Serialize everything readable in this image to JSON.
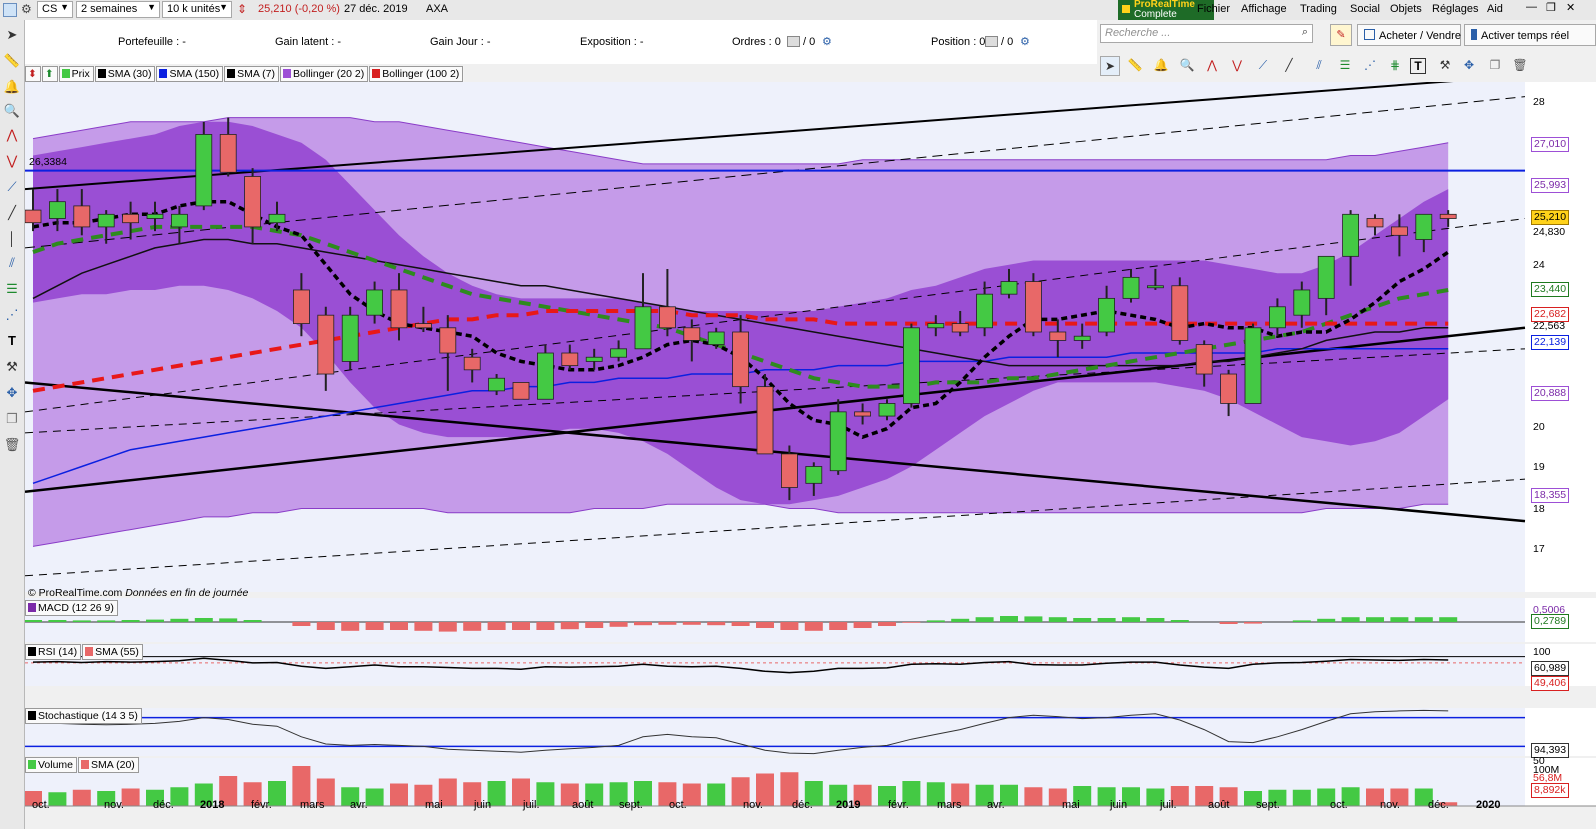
{
  "topbar": {
    "symbol": "CS",
    "period": "2 semaines",
    "units": "10 k unités",
    "price_change": "25,210 (-0,20 %)",
    "date": "27 déc. 2019",
    "name": "AXA",
    "brand_line1": "ProRealTime",
    "brand_line2": "Complete",
    "menu": [
      "Fichier",
      "Affichage",
      "Trading",
      "Social",
      "Objets",
      "Réglages",
      "Aid"
    ]
  },
  "info": {
    "portefeuille": "Portefeuille : -",
    "gain_latent": "Gain latent : -",
    "gain_jour": "Gain Jour : -",
    "exposition": "Exposition : -",
    "ordres": "Ordres : 0",
    "ordres_b": "/ 0",
    "position": "Position : 0",
    "position_b": "/ 0"
  },
  "right_panel": {
    "search_placeholder": "Recherche ...",
    "buy_sell": "Acheter / Vendre",
    "realtime": "Activer temps réel"
  },
  "legend": [
    {
      "label": "Prix",
      "color": "#44c944"
    },
    {
      "label": "SMA (30)",
      "color": "#000000"
    },
    {
      "label": "SMA (150)",
      "color": "#0b20e0"
    },
    {
      "label": "SMA (7)",
      "color": "#000000"
    },
    {
      "label": "Bollinger (20 2)",
      "color": "#9d4fd6"
    },
    {
      "label": "Bollinger (100 2)",
      "color": "#d82020"
    }
  ],
  "level_label": "26,3384",
  "copyright": "© ProRealTime.com",
  "copyright_note": "Données en fin de journée",
  "panels": {
    "macd": "MACD (12 26 9)",
    "rsi": "RSI (14)",
    "rsi_sma": "SMA (55)",
    "stoch": "Stochastique (14 3 5)",
    "volume": "Volume",
    "volume_sma": "SMA (20)"
  },
  "price_axis": [
    "28",
    "27,010",
    "25,993",
    "25,210",
    "24,830",
    "24",
    "23,440",
    "22,682",
    "22,563",
    "22,139",
    "20,888",
    "20",
    "19",
    "18,355",
    "18",
    "17"
  ],
  "indicator_axis": [
    "0,5006",
    "0,2789",
    "100",
    "60,989",
    "49,406",
    "94,393",
    "50",
    "100M",
    "56,8M",
    "8,892k"
  ],
  "months": [
    "oct.",
    "nov.",
    "déc.",
    "2018",
    "févr.",
    "mars",
    "avr.",
    "mai",
    "juin",
    "juil.",
    "août",
    "sept.",
    "oct.",
    "nov.",
    "déc.",
    "2019",
    "févr.",
    "mars",
    "avr.",
    "mai",
    "juin",
    "juil.",
    "août",
    "sept.",
    "oct.",
    "nov.",
    "déc.",
    "2020"
  ],
  "chart_data": {
    "type": "candlestick",
    "symbol": "AXA",
    "period": "2 semaines",
    "ylim": [
      16.6,
      28.4
    ],
    "candles": [
      {
        "o": 25.4,
        "h": 25.9,
        "l": 24.9,
        "c": 25.1
      },
      {
        "o": 25.2,
        "h": 25.9,
        "l": 24.9,
        "c": 25.6
      },
      {
        "o": 25.5,
        "h": 25.9,
        "l": 24.8,
        "c": 25.0
      },
      {
        "o": 25.0,
        "h": 25.4,
        "l": 24.6,
        "c": 25.3
      },
      {
        "o": 25.3,
        "h": 25.6,
        "l": 24.7,
        "c": 25.1
      },
      {
        "o": 25.2,
        "h": 25.6,
        "l": 24.9,
        "c": 25.3
      },
      {
        "o": 25.0,
        "h": 25.5,
        "l": 24.6,
        "c": 25.3
      },
      {
        "o": 25.5,
        "h": 27.5,
        "l": 25.4,
        "c": 27.2
      },
      {
        "o": 27.2,
        "h": 27.6,
        "l": 26.2,
        "c": 26.3
      },
      {
        "o": 26.2,
        "h": 26.4,
        "l": 24.6,
        "c": 25.0
      },
      {
        "o": 25.1,
        "h": 25.6,
        "l": 24.9,
        "c": 25.3
      },
      {
        "o": 23.5,
        "h": 23.9,
        "l": 22.4,
        "c": 22.7
      },
      {
        "o": 22.9,
        "h": 23.1,
        "l": 21.1,
        "c": 21.5
      },
      {
        "o": 21.8,
        "h": 23.1,
        "l": 21.6,
        "c": 22.9
      },
      {
        "o": 22.9,
        "h": 23.7,
        "l": 22.7,
        "c": 23.5
      },
      {
        "o": 23.5,
        "h": 23.9,
        "l": 22.3,
        "c": 22.6
      },
      {
        "o": 22.7,
        "h": 23.1,
        "l": 22.5,
        "c": 22.6
      },
      {
        "o": 22.6,
        "h": 22.9,
        "l": 21.1,
        "c": 22.0
      },
      {
        "o": 21.9,
        "h": 22.1,
        "l": 21.3,
        "c": 21.6
      },
      {
        "o": 21.1,
        "h": 21.5,
        "l": 21.0,
        "c": 21.4
      },
      {
        "o": 21.3,
        "h": 21.3,
        "l": 20.9,
        "c": 20.9
      },
      {
        "o": 20.9,
        "h": 22.2,
        "l": 20.9,
        "c": 22.0
      },
      {
        "o": 22.0,
        "h": 22.2,
        "l": 21.6,
        "c": 21.7
      },
      {
        "o": 21.8,
        "h": 22.1,
        "l": 21.6,
        "c": 21.9
      },
      {
        "o": 21.9,
        "h": 22.3,
        "l": 21.8,
        "c": 22.1
      },
      {
        "o": 22.1,
        "h": 23.9,
        "l": 22.1,
        "c": 23.1
      },
      {
        "o": 23.1,
        "h": 24.0,
        "l": 22.4,
        "c": 22.6
      },
      {
        "o": 22.6,
        "h": 22.8,
        "l": 21.8,
        "c": 22.3
      },
      {
        "o": 22.2,
        "h": 22.6,
        "l": 22.1,
        "c": 22.5
      },
      {
        "o": 22.5,
        "h": 22.9,
        "l": 20.8,
        "c": 21.2
      },
      {
        "o": 21.2,
        "h": 21.5,
        "l": 19.9,
        "c": 19.6
      },
      {
        "o": 19.6,
        "h": 19.8,
        "l": 18.5,
        "c": 18.8
      },
      {
        "o": 18.9,
        "h": 19.4,
        "l": 18.6,
        "c": 19.3
      },
      {
        "o": 19.2,
        "h": 20.9,
        "l": 19.1,
        "c": 20.6
      },
      {
        "o": 20.6,
        "h": 20.8,
        "l": 20.3,
        "c": 20.5
      },
      {
        "o": 20.5,
        "h": 20.9,
        "l": 20.4,
        "c": 20.8
      },
      {
        "o": 20.8,
        "h": 22.7,
        "l": 20.7,
        "c": 22.6
      },
      {
        "o": 22.6,
        "h": 22.9,
        "l": 22.4,
        "c": 22.7
      },
      {
        "o": 22.7,
        "h": 23.0,
        "l": 22.4,
        "c": 22.5
      },
      {
        "o": 22.6,
        "h": 23.7,
        "l": 22.4,
        "c": 23.4
      },
      {
        "o": 23.4,
        "h": 24.0,
        "l": 23.3,
        "c": 23.7
      },
      {
        "o": 23.7,
        "h": 23.9,
        "l": 22.4,
        "c": 22.5
      },
      {
        "o": 22.5,
        "h": 22.8,
        "l": 21.9,
        "c": 22.3
      },
      {
        "o": 22.3,
        "h": 22.7,
        "l": 22.1,
        "c": 22.4
      },
      {
        "o": 22.5,
        "h": 23.6,
        "l": 22.4,
        "c": 23.3
      },
      {
        "o": 23.3,
        "h": 24.0,
        "l": 23.2,
        "c": 23.8
      },
      {
        "o": 23.6,
        "h": 24.0,
        "l": 23.5,
        "c": 23.6
      },
      {
        "o": 23.6,
        "h": 23.8,
        "l": 22.2,
        "c": 22.3
      },
      {
        "o": 22.2,
        "h": 22.3,
        "l": 21.2,
        "c": 21.5
      },
      {
        "o": 21.5,
        "h": 21.6,
        "l": 20.5,
        "c": 20.8
      },
      {
        "o": 20.8,
        "h": 22.7,
        "l": 20.8,
        "c": 22.6
      },
      {
        "o": 22.6,
        "h": 23.3,
        "l": 22.4,
        "c": 23.1
      },
      {
        "o": 22.9,
        "h": 23.7,
        "l": 22.6,
        "c": 23.5
      },
      {
        "o": 23.3,
        "h": 24.3,
        "l": 22.9,
        "c": 24.3
      },
      {
        "o": 24.3,
        "h": 25.4,
        "l": 23.6,
        "c": 25.3
      },
      {
        "o": 25.2,
        "h": 25.3,
        "l": 24.8,
        "c": 25.0
      },
      {
        "o": 25.0,
        "h": 25.3,
        "l": 24.3,
        "c": 24.8
      },
      {
        "o": 24.7,
        "h": 25.3,
        "l": 24.4,
        "c": 25.3
      },
      {
        "o": 25.3,
        "h": 25.4,
        "l": 25.0,
        "c": 25.2
      }
    ],
    "sma7": [
      25.0,
      25.1,
      25.1,
      25.2,
      25.3,
      25.3,
      25.5,
      25.6,
      25.6,
      25.3,
      25.0,
      24.8,
      24.1,
      23.4,
      23.0,
      22.7,
      22.6,
      22.5,
      22.4,
      22.0,
      21.8,
      21.7,
      21.6,
      21.6,
      21.7,
      21.9,
      22.2,
      22.3,
      22.2,
      21.9,
      21.4,
      20.8,
      20.4,
      20.3,
      20.0,
      20.2,
      20.7,
      20.8,
      21.3,
      21.9,
      22.4,
      22.8,
      22.8,
      22.9,
      23.0,
      22.9,
      22.8,
      22.6,
      22.7,
      22.6,
      22.6,
      22.4,
      22.5,
      22.5,
      22.8,
      23.2,
      23.7,
      24.0,
      24.4
    ],
    "sma30": [
      23.3,
      23.6,
      23.9,
      24.1,
      24.3,
      24.5,
      24.6,
      24.7,
      24.7,
      24.6,
      24.6,
      24.5,
      24.4,
      24.3,
      24.2,
      24.1,
      24.0,
      23.9,
      23.8,
      23.7,
      23.6,
      23.6,
      23.5,
      23.4,
      23.3,
      23.2,
      23.1,
      23.0,
      22.9,
      22.8,
      22.7,
      22.6,
      22.5,
      22.4,
      22.3,
      22.2,
      22.1,
      22.0,
      21.9,
      21.8,
      21.7,
      21.7,
      21.7,
      21.7,
      21.7,
      21.7,
      21.7,
      21.7,
      21.8,
      21.8,
      21.9,
      22.0,
      22.1,
      22.3,
      22.4,
      22.5,
      22.5,
      22.6,
      22.6
    ],
    "sma150": [
      18.9,
      19.1,
      19.3,
      19.5,
      19.7,
      19.8,
      19.9,
      20.0,
      20.1,
      20.2,
      20.3,
      20.4,
      20.5,
      20.6,
      20.7,
      20.8,
      20.9,
      21.0,
      21.1,
      21.1,
      21.2,
      21.2,
      21.3,
      21.3,
      21.4,
      21.4,
      21.4,
      21.5,
      21.5,
      21.5,
      21.6,
      21.6,
      21.6,
      21.7,
      21.7,
      21.7,
      21.8,
      21.8,
      21.8,
      21.8,
      21.9,
      21.9,
      21.9,
      21.9,
      21.9,
      22.0,
      22.0,
      22.0,
      22.0,
      22.0,
      22.0,
      22.1,
      22.1,
      22.1,
      22.1,
      22.1,
      22.1,
      22.1,
      22.1
    ],
    "sma_green": [
      24.4,
      24.6,
      24.7,
      24.8,
      24.9,
      25.0,
      25.0,
      25.0,
      25.0,
      25.0,
      24.9,
      24.8,
      24.6,
      24.4,
      24.2,
      24.0,
      23.8,
      23.6,
      23.4,
      23.3,
      23.2,
      23.1,
      23.0,
      22.9,
      22.8,
      22.7,
      22.6,
      22.4,
      22.2,
      22.0,
      21.8,
      21.6,
      21.4,
      21.3,
      21.2,
      21.2,
      21.2,
      21.3,
      21.3,
      21.3,
      21.4,
      21.4,
      21.5,
      21.6,
      21.7,
      21.8,
      21.9,
      22.0,
      22.1,
      22.2,
      22.3,
      22.4,
      22.5,
      22.7,
      22.9,
      23.1,
      23.3,
      23.4,
      23.5
    ],
    "sma_red": [
      21.1,
      21.2,
      21.3,
      21.4,
      21.5,
      21.6,
      21.7,
      21.8,
      21.9,
      22.0,
      22.1,
      22.2,
      22.3,
      22.4,
      22.5,
      22.6,
      22.7,
      22.8,
      22.8,
      22.9,
      22.9,
      23.0,
      23.0,
      23.0,
      23.0,
      23.0,
      23.0,
      22.9,
      22.9,
      22.9,
      22.8,
      22.8,
      22.8,
      22.7,
      22.7,
      22.7,
      22.7,
      22.7,
      22.7,
      22.7,
      22.7,
      22.7,
      22.7,
      22.7,
      22.7,
      22.7,
      22.7,
      22.7,
      22.7,
      22.7,
      22.7,
      22.7,
      22.7,
      22.7,
      22.7,
      22.7,
      22.7,
      22.7,
      22.7
    ],
    "bb20_upper": [
      26.7,
      26.8,
      26.9,
      27.0,
      27.1,
      27.2,
      27.4,
      27.5,
      27.5,
      27.4,
      27.2,
      27.0,
      26.6,
      26.0,
      25.4,
      24.8,
      24.3,
      23.9,
      23.6,
      23.4,
      23.3,
      23.3,
      23.3,
      23.3,
      23.3,
      23.2,
      23.1,
      23.0,
      23.0,
      23.0,
      23.0,
      23.0,
      23.0,
      23.1,
      23.2,
      23.3,
      23.5,
      23.6,
      23.8,
      24.0,
      24.1,
      24.2,
      24.2,
      24.2,
      24.2,
      24.2,
      24.2,
      24.2,
      24.2,
      24.1,
      24.0,
      23.9,
      23.9,
      24.1,
      24.4,
      24.8,
      25.2,
      25.6,
      25.9
    ],
    "bb20_lower": [
      23.2,
      23.3,
      23.4,
      23.4,
      23.5,
      23.5,
      23.6,
      23.6,
      23.5,
      23.3,
      23.0,
      22.6,
      22.0,
      21.3,
      20.7,
      20.3,
      20.1,
      20.0,
      20.0,
      20.0,
      20.0,
      20.1,
      20.2,
      20.2,
      20.1,
      19.9,
      19.6,
      19.2,
      18.8,
      18.5,
      18.4,
      18.4,
      18.5,
      18.6,
      18.8,
      19.0,
      19.3,
      19.7,
      20.1,
      20.5,
      20.8,
      21.1,
      21.3,
      21.3,
      21.3,
      21.3,
      21.3,
      21.2,
      21.1,
      20.9,
      20.6,
      20.3,
      20.0,
      19.9,
      19.8,
      19.9,
      20.1,
      20.5,
      20.9
    ],
    "bb100_upper": [
      27.1,
      27.2,
      27.3,
      27.4,
      27.5,
      27.5,
      27.5,
      27.5,
      27.6,
      27.6,
      27.6,
      27.6,
      27.6,
      27.6,
      27.5,
      27.5,
      27.4,
      27.3,
      27.2,
      27.1,
      27.0,
      26.9,
      26.8,
      26.7,
      26.6,
      26.5,
      26.5,
      26.5,
      26.5,
      26.5,
      26.5,
      26.5,
      26.5,
      26.5,
      26.6,
      26.6,
      26.6,
      26.6,
      26.6,
      26.6,
      26.6,
      26.6,
      26.6,
      26.6,
      26.6,
      26.6,
      26.6,
      26.6,
      26.6,
      26.6,
      26.6,
      26.6,
      26.6,
      26.6,
      26.7,
      26.7,
      26.8,
      26.9,
      27.0
    ],
    "bb100_lower": [
      17.4,
      17.5,
      17.6,
      17.7,
      17.8,
      17.9,
      18.0,
      18.1,
      18.1,
      18.2,
      18.2,
      18.3,
      18.3,
      18.3,
      18.3,
      18.3,
      18.3,
      18.2,
      18.2,
      18.2,
      18.2,
      18.2,
      18.2,
      18.3,
      18.3,
      18.3,
      18.4,
      18.4,
      18.4,
      18.4,
      18.4,
      18.3,
      18.3,
      18.2,
      18.2,
      18.2,
      18.2,
      18.2,
      18.2,
      18.2,
      18.2,
      18.2,
      18.2,
      18.2,
      18.2,
      18.2,
      18.2,
      18.2,
      18.2,
      18.2,
      18.2,
      18.2,
      18.2,
      18.3,
      18.3,
      18.3,
      18.3,
      18.4,
      18.4
    ],
    "horizontal_level": 26.3384,
    "macd_hist": [
      0.05,
      0.05,
      0.04,
      0.04,
      0.05,
      0.06,
      0.08,
      0.1,
      0.09,
      0.05,
      0.0,
      -0.1,
      -0.2,
      -0.22,
      -0.2,
      -0.2,
      -0.22,
      -0.24,
      -0.22,
      -0.2,
      -0.2,
      -0.2,
      -0.18,
      -0.15,
      -0.12,
      -0.08,
      -0.07,
      -0.07,
      -0.08,
      -0.1,
      -0.15,
      -0.2,
      -0.22,
      -0.2,
      -0.15,
      -0.1,
      -0.02,
      0.04,
      0.08,
      0.12,
      0.15,
      0.14,
      0.12,
      0.1,
      0.1,
      0.12,
      0.1,
      0.05,
      0.0,
      -0.05,
      -0.04,
      0.0,
      0.04,
      0.08,
      0.12,
      0.12,
      0.12,
      0.12,
      0.12
    ],
    "rsi": [
      57,
      58,
      56,
      58,
      57,
      58,
      60,
      66,
      61,
      55,
      56,
      47,
      42,
      46,
      50,
      46,
      46,
      44,
      42,
      42,
      40,
      46,
      45,
      46,
      47,
      52,
      47,
      46,
      47,
      42,
      35,
      32,
      35,
      42,
      42,
      43,
      52,
      53,
      52,
      56,
      58,
      51,
      50,
      50,
      54,
      57,
      57,
      50,
      45,
      42,
      52,
      55,
      56,
      59,
      63,
      62,
      61,
      63,
      62
    ],
    "stoch": [
      70,
      68,
      66,
      65,
      66,
      68,
      72,
      80,
      76,
      66,
      62,
      40,
      25,
      22,
      24,
      22,
      20,
      14,
      12,
      10,
      8,
      12,
      15,
      18,
      22,
      40,
      45,
      40,
      38,
      25,
      12,
      6,
      5,
      12,
      18,
      22,
      35,
      45,
      55,
      68,
      80,
      85,
      82,
      78,
      80,
      85,
      88,
      75,
      55,
      30,
      28,
      40,
      55,
      72,
      88,
      92,
      94,
      95,
      94
    ],
    "volume": [
      12,
      11,
      13,
      12,
      14,
      13,
      15,
      18,
      24,
      19,
      20,
      32,
      22,
      15,
      14,
      18,
      17,
      22,
      19,
      20,
      22,
      19,
      18,
      18,
      19,
      20,
      19,
      18,
      18,
      23,
      26,
      27,
      20,
      17,
      17,
      16,
      20,
      19,
      18,
      17,
      17,
      15,
      14,
      16,
      15,
      15,
      14,
      16,
      16,
      15,
      12,
      13,
      13,
      14,
      15,
      14,
      14,
      14,
      3
    ],
    "colors": {
      "up": "#44c944",
      "down": "#e86868",
      "band100": "#bb88e6",
      "band20": "#9d4fd6"
    }
  }
}
